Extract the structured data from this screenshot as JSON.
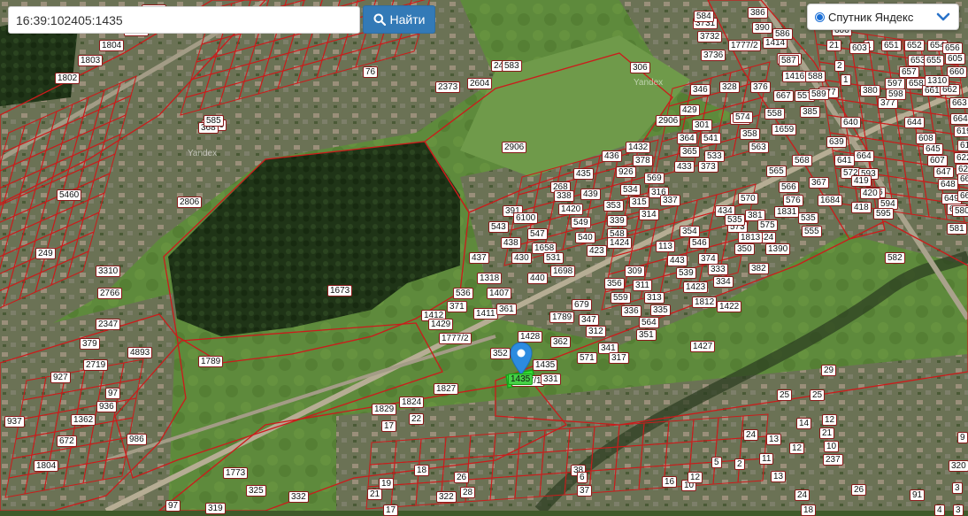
{
  "search": {
    "value": "16:39:102405:1435",
    "button_label": "Найти"
  },
  "layer_select": {
    "selected": "Спутник Яндекс"
  },
  "watermarks": [
    "Yandex",
    "Yandex"
  ],
  "selected_parcel": "1435",
  "parcels": [
    "1805",
    "1806",
    "1804",
    "1803",
    "1802",
    "5460",
    "2485",
    "2604",
    "2373",
    "76",
    "3731",
    "3732",
    "3736",
    "1777/2",
    "386",
    "390",
    "1414",
    "1415",
    "1416",
    "557",
    "385",
    "376",
    "328",
    "346",
    "306",
    "2906",
    "2906",
    "429",
    "301",
    "364",
    "541",
    "365",
    "533",
    "433",
    "373",
    "422",
    "558",
    "358",
    "563",
    "1659",
    "574",
    "368",
    "5460",
    "2806",
    "249",
    "3310",
    "2766",
    "2347",
    "379",
    "2719",
    "4893",
    "927",
    "97",
    "936",
    "1362",
    "937",
    "672",
    "1804",
    "986",
    "1773",
    "325",
    "332",
    "97",
    "319",
    "268",
    "435",
    "436",
    "926",
    "378",
    "1432",
    "534",
    "569",
    "316",
    "315",
    "337",
    "314",
    "338",
    "439",
    "1420",
    "353",
    "549",
    "339",
    "540",
    "548",
    "423",
    "391",
    "6100",
    "438",
    "547",
    "430",
    "1658",
    "531",
    "543",
    "437",
    "1698",
    "440",
    "1424",
    "1318",
    "536",
    "1407",
    "371",
    "1411",
    "361",
    "1412",
    "1429",
    "1777/2",
    "1673",
    "1789",
    "1789",
    "679",
    "347",
    "312",
    "571",
    "341",
    "317",
    "356",
    "309",
    "559",
    "311",
    "336",
    "313",
    "335",
    "564",
    "351",
    "352",
    "1428",
    "362",
    "1777/1",
    "1435",
    "331",
    "1427",
    "113",
    "354",
    "443",
    "546",
    "374",
    "539",
    "333",
    "1423",
    "334",
    "1812",
    "1422",
    "434",
    "381",
    "573",
    "575",
    "1424",
    "350",
    "1390",
    "382",
    "565",
    "568",
    "566",
    "367",
    "576",
    "1684",
    "535",
    "555",
    "570",
    "535",
    "1813",
    "1831",
    "1827",
    "1829",
    "1824",
    "17",
    "22",
    "29",
    "25",
    "25",
    "14",
    "13",
    "12",
    "21",
    "10",
    "237",
    "24",
    "26",
    "24",
    "11",
    "13",
    "12",
    "5",
    "2",
    "3",
    "91",
    "320",
    "19",
    "18",
    "322",
    "21",
    "17",
    "26",
    "28",
    "38",
    "6",
    "37",
    "16",
    "10",
    "12",
    "18",
    "9",
    "4",
    "3",
    "21",
    "2",
    "1",
    "1",
    "639",
    "640",
    "641",
    "664",
    "572",
    "593",
    "419",
    "596",
    "420",
    "594",
    "418",
    "595",
    "380",
    "597",
    "377",
    "598",
    "644",
    "608",
    "645",
    "607",
    "647",
    "648",
    "649",
    "650",
    "651",
    "652",
    "653",
    "654",
    "655",
    "656",
    "657",
    "658",
    "661",
    "662",
    "663",
    "664",
    "619",
    "616",
    "622",
    "623",
    "665",
    "666",
    "667",
    "577",
    "580",
    "581",
    "582",
    "583",
    "584",
    "585",
    "586",
    "587",
    "588",
    "589",
    "605",
    "606",
    "603",
    "660",
    "1310",
    "2485",
    "3731",
    "5460",
    "1414",
    "557",
    "599",
    "601",
    "602",
    "643",
    "642",
    "621",
    "617"
  ]
}
